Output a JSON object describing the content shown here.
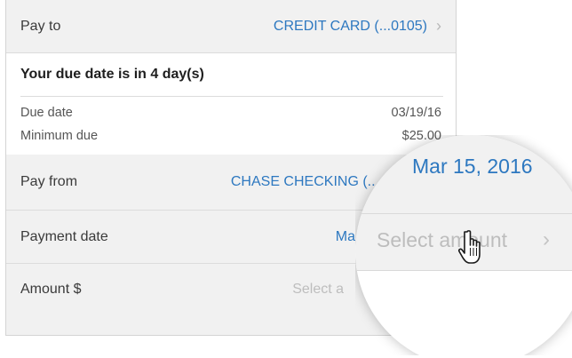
{
  "pay_to": {
    "label": "Pay to",
    "value": "CREDIT CARD (...0105)"
  },
  "due_notice": "Your due date is in 4 day(s)",
  "due_date": {
    "label": "Due date",
    "value": "03/19/16"
  },
  "minimum_due": {
    "label": "Minimum due",
    "value": "$25.00"
  },
  "pay_from": {
    "label": "Pay from",
    "value": "CHASE CHECKING (..."
  },
  "payment_date": {
    "label": "Payment date",
    "value_partial": "Ma"
  },
  "amount": {
    "label": "Amount $",
    "placeholder_partial": "Select a"
  },
  "magnifier": {
    "date": "Mar 15, 2016",
    "select_amount": "Select amount"
  },
  "colors": {
    "link_blue": "#2d78c0",
    "row_gray": "#f1f1f1"
  },
  "icons": [
    "chevron-right-icon",
    "hand-pointer-cursor-icon"
  ]
}
